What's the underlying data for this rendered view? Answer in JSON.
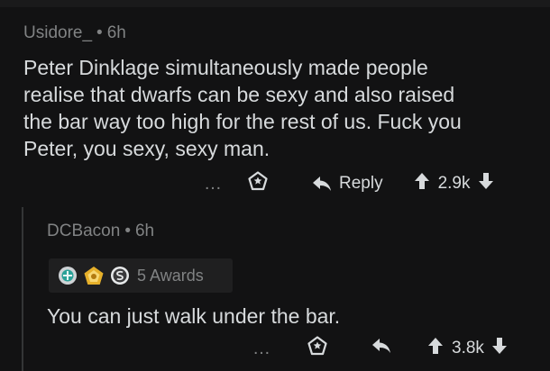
{
  "comments": [
    {
      "author": "Usidore_",
      "age": "6h",
      "lines": [
        "Peter Dinklage simultaneously made people",
        "realise that dwarfs can be sexy and also raised",
        "the bar way too high for the rest of us. Fuck you",
        "Peter, you sexy, sexy man."
      ],
      "more_label": "…",
      "reply_label": "Reply",
      "score": "2.9k"
    },
    {
      "author": "DCBacon",
      "age": "6h",
      "awards_label": "5 Awards",
      "text": "You can just walk under the bar.",
      "more_label": "…",
      "score": "3.8k"
    }
  ],
  "separator": "•",
  "icons": {
    "award": "award-icon",
    "reply": "reply-arrow-icon",
    "upvote": "upvote-arrow-icon",
    "downvote": "downvote-arrow-icon",
    "more": "more-dots-icon"
  }
}
